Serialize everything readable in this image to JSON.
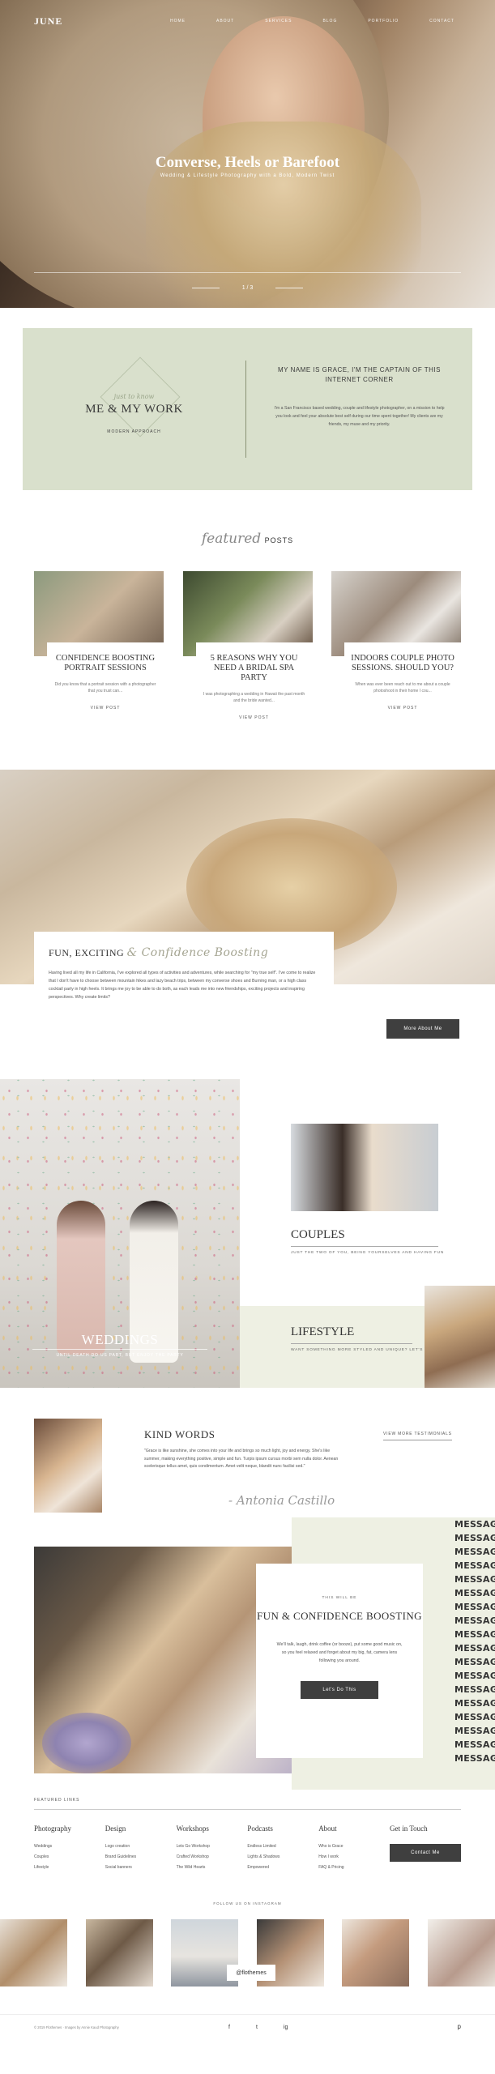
{
  "nav": {
    "logo": "JUNE",
    "links": [
      "HOME",
      "ABOUT",
      "SERVICES",
      "BLOG",
      "PORTFOLIO",
      "CONTACT"
    ]
  },
  "hero": {
    "title": "Converse, Heels or Barefoot",
    "subtitle": "Wedding & Lifestyle Photography with a Bold, Modern Twist",
    "pager": "1 / 3"
  },
  "about": {
    "script": "just to know",
    "title": "ME & MY WORK",
    "sub": "MODERN APPROACH",
    "heading": "MY NAME IS GRACE, I'M THE CAPTAIN OF THIS INTERNET CORNER",
    "text": "I'm a San Francisco based wedding, couple and lifestyle photographer, on a mission to help you look and feel your absolute best self during our time spent together! My clients are my friends, my muse and my priority."
  },
  "featured": {
    "script": "featured",
    "bold": "POSTS",
    "posts": [
      {
        "title": "CONFIDENCE BOOSTING PORTRAIT SESSIONS",
        "excerpt": "Did you know that a portrait session with a photographer that you trust can...",
        "cta": "VIEW POST"
      },
      {
        "title": "5 REASONS WHY YOU NEED A BRIDAL SPA PARTY",
        "excerpt": "I was photographing a wedding in Hawaii the past month and the bride wanted...",
        "cta": "VIEW POST"
      },
      {
        "title": "INDOORS COUPLE PHOTO SESSIONS. SHOULD YOU?",
        "excerpt": "When was ever been reach out to me about a couple photoshoot in their home I cou...",
        "cta": "VIEW POST"
      }
    ]
  },
  "fun": {
    "title": "FUN, EXCITING",
    "script": "& Confidence Boosting",
    "text": "Having lived all my life in California, I've explored all types of activities and adventures, while searching for \"my true self\". I've come to realize that I don't have to choose between mountain hikes and lazy beach trips, between my converse shoes and Burning man, or a high class cocktail party in high heels. It brings me joy to be able to do both, as each leads me into new friendships, exciting projects and inspiring perspectives. Why create limits?",
    "button": "More About Me"
  },
  "gallery": {
    "weddings": {
      "title": "WEDDINGS",
      "desc": "UNTIL DEATH DO US PART, BUT ENJOY THE PARTY"
    },
    "couples": {
      "title": "COUPLES",
      "desc": "JUST THE TWO OF YOU, BEING YOURSELVES AND HAVING FUN"
    },
    "lifestyle": {
      "title": "LIFESTYLE",
      "desc": "WANT SOMETHING MORE STYLED AND UNIQUE? LET'S"
    }
  },
  "kind": {
    "title": "KIND WORDS",
    "more": "VIEW MORE TESTIMONIALS",
    "quote": "\"Grace is like sunshine, she comes into your life and brings so much light, joy and energy. She's like summer, making everything positive, simple and fun. Turpis ipsum cursus morbi sem nulla dolor. Aenean scelerisque tellus amet, quis condimentum. Amet velit neque, blandit nunc facilisi sed.\"",
    "signature": "- Antonia Castillo"
  },
  "confidence": {
    "small": "THIS WILL BE",
    "title": "FUN & CONFIDENCE BOOSTING",
    "text": "We'll talk, laugh, drink coffee (or booze), put some good music on, so you feel relaxed and forget about my big, fat, camera lens following you around.",
    "button": "Let's Do This",
    "marquee": [
      "MESSAGE",
      "MESSAGE",
      "MESSAGE",
      "MESSAGE",
      "MESSAGE",
      "MESSAGE",
      "MESSAGE",
      "MESSAGE",
      "MESSAGE",
      "MESSAGE",
      "MESSAGE",
      "MESSAGE",
      "MESSAGE",
      "MESSAGE",
      "MESSAGE",
      "MESSAGE",
      "MESSAGE",
      "MESSAGE"
    ]
  },
  "links": {
    "label": "FEATURED LINKS",
    "cols": [
      {
        "h": "Photography",
        "items": [
          "Weddings",
          "Couples",
          "Lifestyle"
        ]
      },
      {
        "h": "Design",
        "items": [
          "Logo creation",
          "Brand Guidelines",
          "Social banners"
        ]
      },
      {
        "h": "Workshops",
        "items": [
          "Lets Go Workshop",
          "Crafted Workshop",
          "The Wild Hearts"
        ]
      },
      {
        "h": "Podcasts",
        "items": [
          "Endless Limited",
          "Lights & Shadows",
          "Empowered"
        ]
      },
      {
        "h": "About",
        "items": [
          "Who is Grace",
          "How I work",
          "FAQ & Pricing"
        ]
      },
      {
        "h": "Get in Touch",
        "items": []
      }
    ],
    "button": "Contact Me"
  },
  "insta": {
    "follow": "FOLLOW US ON INSTAGRAM",
    "handle": "@flothemes"
  },
  "bottom": {
    "copy": "© 2019 Flothemes · Images by Annie Kaud Photography",
    "social": [
      "f",
      "t",
      "ig"
    ],
    "pin": "p"
  }
}
